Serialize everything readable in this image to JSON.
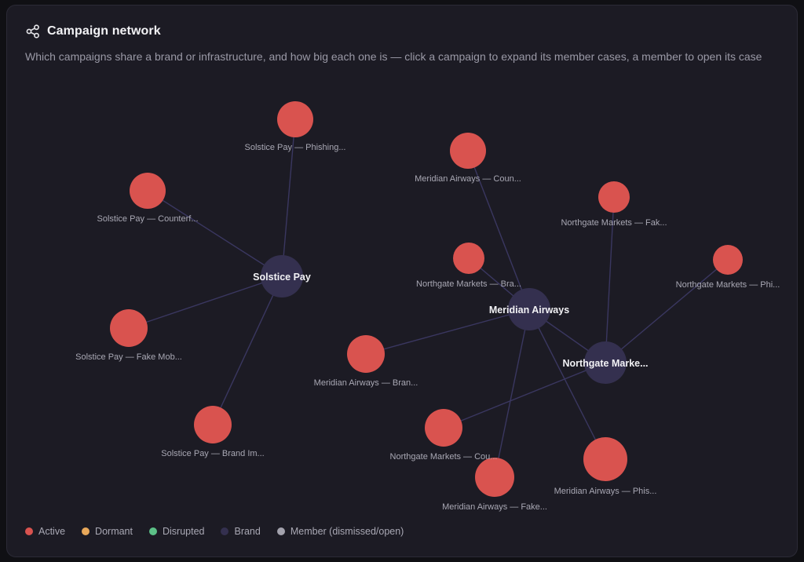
{
  "header": {
    "title": "Campaign network",
    "subtitle": "Which campaigns share a brand or infrastructure, and how big each one is — click a campaign to expand its member cases, a member to open its case",
    "icon": "share-icon"
  },
  "colors": {
    "active": "#d9534f",
    "dormant": "#e8a85a",
    "disrupted": "#5cc087",
    "brand": "#34304f",
    "member": "#a3a2ad",
    "edge": "#3a3760"
  },
  "legend": [
    {
      "label": "Active",
      "color": "#d9534f"
    },
    {
      "label": "Dormant",
      "color": "#e8a85a"
    },
    {
      "label": "Disrupted",
      "color": "#5cc087"
    },
    {
      "label": "Brand",
      "color": "#34304f"
    },
    {
      "label": "Member (dismissed/open)",
      "color": "#a3a2ad"
    }
  ],
  "network": {
    "brands": [
      {
        "id": "b-solstice",
        "label": "Solstice Pay"
      },
      {
        "id": "b-meridian",
        "label": "Meridian Airways"
      },
      {
        "id": "b-northgate",
        "label": "Northgate Marke..."
      }
    ],
    "campaigns": [
      {
        "id": "c1",
        "label": "Solstice Pay — Phishing...",
        "status": "active",
        "brand": "b-solstice"
      },
      {
        "id": "c2",
        "label": "Solstice Pay — Counterf...",
        "status": "active",
        "brand": "b-solstice"
      },
      {
        "id": "c3",
        "label": "Solstice Pay — Fake Mob...",
        "status": "active",
        "brand": "b-solstice"
      },
      {
        "id": "c4",
        "label": "Solstice Pay — Brand Im...",
        "status": "active",
        "brand": "b-solstice"
      },
      {
        "id": "c5",
        "label": "Meridian Airways — Coun...",
        "status": "active",
        "brand": "b-meridian"
      },
      {
        "id": "c6",
        "label": "Northgate Markets — Bra...",
        "status": "active",
        "brand": "b-meridian"
      },
      {
        "id": "c7",
        "label": "Meridian Airways — Bran...",
        "status": "active",
        "brand": "b-meridian"
      },
      {
        "id": "c8",
        "label": "Meridian Airways — Fake...",
        "status": "active",
        "brand": "b-meridian"
      },
      {
        "id": "c9",
        "label": "Meridian Airways — Phis...",
        "status": "active",
        "brand": "b-meridian"
      },
      {
        "id": "c10",
        "label": "Northgate Markets — Fak...",
        "status": "active",
        "brand": "b-northgate"
      },
      {
        "id": "c11",
        "label": "Northgate Markets — Phi...",
        "status": "active",
        "brand": "b-northgate"
      },
      {
        "id": "c12",
        "label": "Northgate Markets — Cou...",
        "status": "active",
        "brand": "b-northgate"
      }
    ],
    "links": [
      {
        "source": "b-meridian",
        "target": "b-northgate"
      }
    ]
  }
}
